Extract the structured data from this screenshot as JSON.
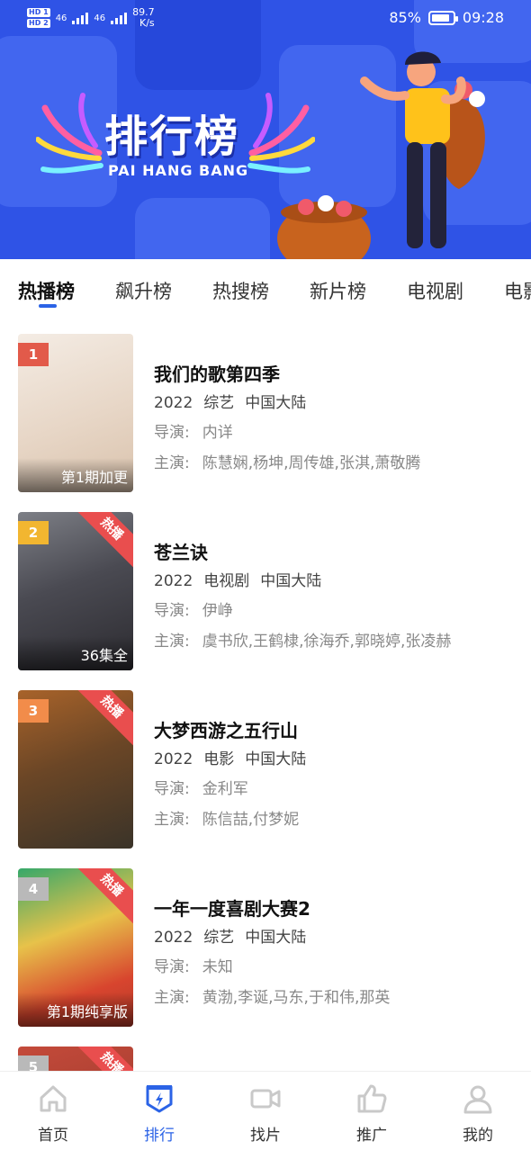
{
  "status_bar": {
    "sim1": "HD 1",
    "sim2": "HD 2",
    "signal1": "46",
    "signal2": "46",
    "net_speed": "89.7",
    "net_unit": "K/s",
    "battery": "85%",
    "battery_level": 0.85,
    "time": "09:28"
  },
  "banner": {
    "title": "排行榜",
    "subtitle": "PAI HANG BANG",
    "colors": {
      "background": "#2f53e6"
    }
  },
  "tabs": [
    {
      "label": "热播榜",
      "active": true
    },
    {
      "label": "飙升榜"
    },
    {
      "label": "热搜榜"
    },
    {
      "label": "新片榜"
    },
    {
      "label": "电视剧"
    },
    {
      "label": "电影"
    }
  ],
  "items": [
    {
      "rank": "1",
      "rank_color": "#e25a4a",
      "title": "我们的歌第四季",
      "year": "2022",
      "genre": "综艺",
      "region": "中国大陆",
      "director_label": "导演:",
      "director": "内详",
      "cast_label": "主演:",
      "cast": "陈慧娴,杨坤,周传雄,张淇,萧敬腾",
      "note": "第1期加更",
      "badge": ""
    },
    {
      "rank": "2",
      "rank_color": "#f2b630",
      "title": "苍兰诀",
      "year": "2022",
      "genre": "电视剧",
      "region": "中国大陆",
      "director_label": "导演:",
      "director": "伊峥",
      "cast_label": "主演:",
      "cast": "虞书欣,王鹤棣,徐海乔,郭晓婷,张凌赫",
      "note": "36集全",
      "badge": "热播"
    },
    {
      "rank": "3",
      "rank_color": "#f28c4a",
      "title": "大梦西游之五行山",
      "year": "2022",
      "genre": "电影",
      "region": "中国大陆",
      "director_label": "导演:",
      "director": "金利军",
      "cast_label": "主演:",
      "cast": "陈信喆,付梦妮",
      "note": "",
      "badge": "热播"
    },
    {
      "rank": "4",
      "rank_color": "#b9b9b9",
      "title": "一年一度喜剧大赛2",
      "year": "2022",
      "genre": "综艺",
      "region": "中国大陆",
      "director_label": "导演:",
      "director": "未知",
      "cast_label": "主演:",
      "cast": "黄渤,李诞,马东,于和伟,那英",
      "note": "第1期纯享版",
      "badge": "热播"
    },
    {
      "rank": "5",
      "rank_color": "#b9b9b9",
      "title": "",
      "badge": "热播"
    }
  ],
  "bottom_nav": [
    {
      "label": "首页",
      "icon": "home-icon"
    },
    {
      "label": "排行",
      "icon": "ranking-icon",
      "active": true
    },
    {
      "label": "找片",
      "icon": "video-camera-icon"
    },
    {
      "label": "推广",
      "icon": "thumbs-up-icon"
    },
    {
      "label": "我的",
      "icon": "user-icon"
    }
  ],
  "colors": {
    "accent": "#2b63e6",
    "hot_badge": "#e94e4e"
  }
}
